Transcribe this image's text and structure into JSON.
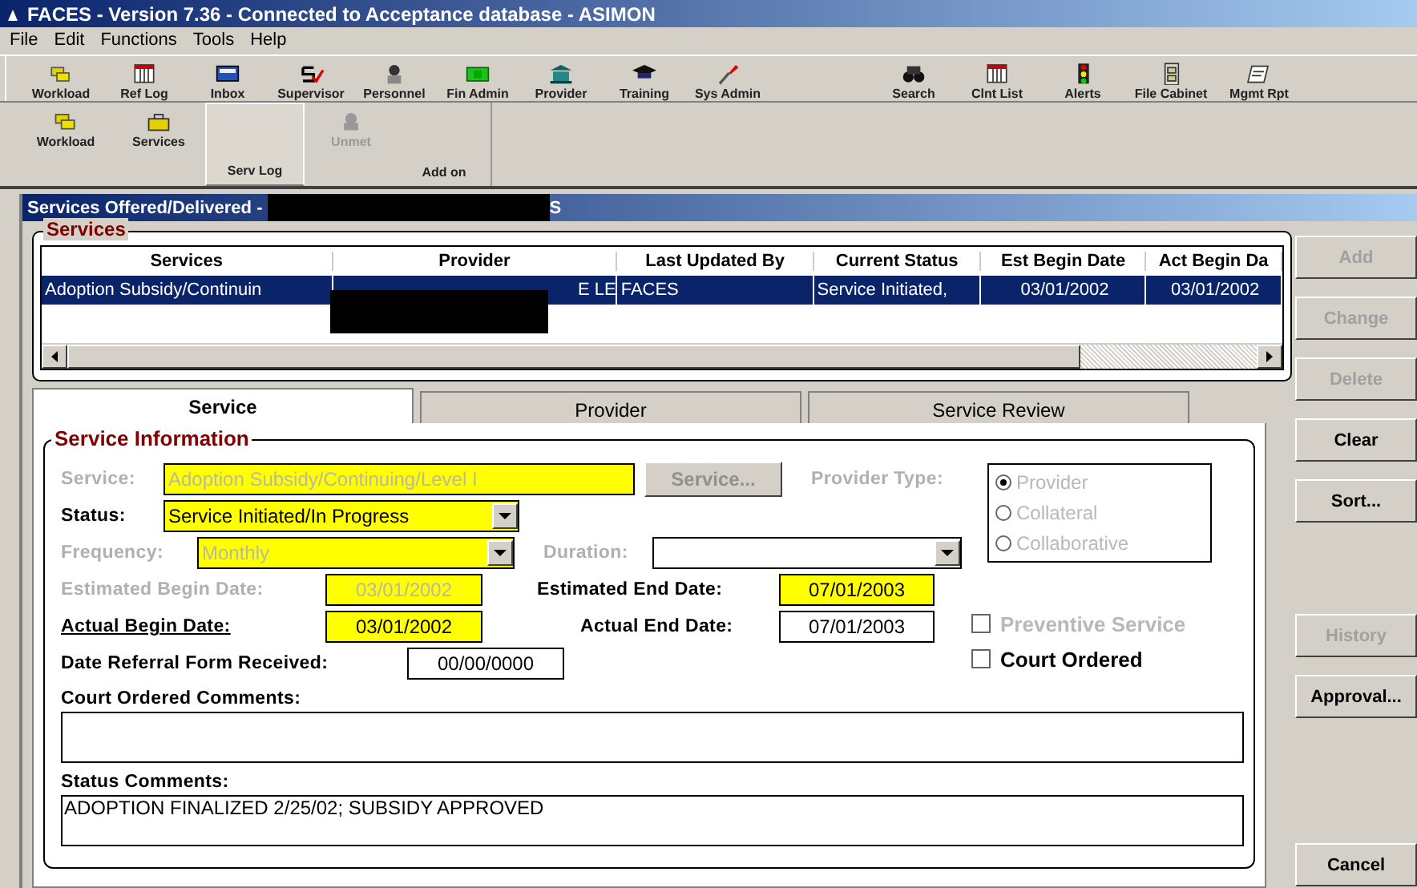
{
  "window": {
    "title": "FACES - Version 7.36 - Connected to Acceptance database - ASIMON"
  },
  "menu": [
    "File",
    "Edit",
    "Functions",
    "Tools",
    "Help"
  ],
  "toolbar": [
    {
      "label": "Workload"
    },
    {
      "label": "Ref Log"
    },
    {
      "label": "Inbox"
    },
    {
      "label": "Supervisor"
    },
    {
      "label": "Personnel"
    },
    {
      "label": "Fin Admin"
    },
    {
      "label": "Provider"
    },
    {
      "label": "Training"
    },
    {
      "label": "Sys Admin"
    },
    {
      "label": "Search"
    },
    {
      "label": "Clnt List"
    },
    {
      "label": "Alerts"
    },
    {
      "label": "File Cabinet"
    },
    {
      "label": "Mgmt Rpt"
    }
  ],
  "subtoolbar": [
    {
      "label": "Workload",
      "selected": false,
      "disabled": false
    },
    {
      "label": "Services",
      "selected": false,
      "disabled": false
    },
    {
      "label": "Serv Log",
      "selected": true,
      "disabled": false
    },
    {
      "label": "Unmet",
      "selected": false,
      "disabled": true
    },
    {
      "label": "Add on",
      "selected": false,
      "disabled": false
    }
  ],
  "document": {
    "title_start": "Services Offered/Delivered - ",
    "title_end": "S"
  },
  "services": {
    "title": "Services",
    "columns": [
      "Services",
      "Provider",
      "Last Updated By",
      "Current Status",
      "Est Begin Date",
      "Act Begin Da"
    ],
    "rows": [
      {
        "selected": true,
        "cells": [
          "Adoption Subsidy/Continuin",
          "E LE",
          "FACES",
          "Service Initiated,",
          "03/01/2002",
          "03/01/2002"
        ]
      }
    ]
  },
  "side_buttons": [
    {
      "label": "Add",
      "disabled": true
    },
    {
      "label": "Change",
      "disabled": true
    },
    {
      "label": "Delete",
      "disabled": true
    },
    {
      "label": "Clear",
      "disabled": false
    },
    {
      "label": "Sort...",
      "disabled": false
    },
    {
      "label": "History",
      "disabled": true
    },
    {
      "label": "Approval...",
      "disabled": false
    },
    {
      "label": "Cancel",
      "disabled": false
    }
  ],
  "tabs": [
    {
      "label": "Service",
      "selected": true
    },
    {
      "label": "Provider",
      "selected": false
    },
    {
      "label": "Service Review",
      "selected": false
    }
  ],
  "service_information": {
    "title": "Service Information",
    "service": {
      "label": "Service:",
      "value": "Adoption Subsidy/Continuing/Level I",
      "disabled": true,
      "required": true
    },
    "service_button": {
      "label": "Service...",
      "disabled": true
    },
    "provider_type": {
      "label": "Provider Type:",
      "disabled": true,
      "options": [
        {
          "label": "Provider",
          "selected": true
        },
        {
          "label": "Collateral",
          "selected": false
        },
        {
          "label": "Collaborative",
          "selected": false
        }
      ]
    },
    "status": {
      "label": "Status:",
      "value": "Service Initiated/In Progress",
      "disabled": false,
      "required": true
    },
    "frequency": {
      "label": "Frequency:",
      "value": "Monthly",
      "disabled": true,
      "required": true
    },
    "duration": {
      "label": "Duration:",
      "disabled": true,
      "required": false
    },
    "est_begin": {
      "label": "Estimated Begin Date:",
      "value": "03/01/2002",
      "disabled": true,
      "required": true
    },
    "est_end": {
      "label": "Estimated End Date:",
      "value": "07/01/2003",
      "disabled": false,
      "required": true
    },
    "act_begin": {
      "label": "Actual Begin Date:",
      "value": "03/01/2002",
      "disabled": false,
      "required": true,
      "underlined": true
    },
    "act_end": {
      "label": "Actual End Date:",
      "value": "07/01/2003",
      "disabled": false,
      "required": false
    },
    "referral": {
      "label": "Date Referral Form Received:",
      "value": "00/00/0000",
      "disabled": false,
      "required": false
    },
    "preventive": {
      "label": "Preventive Service",
      "checked": false,
      "disabled": true
    },
    "court_ordered": {
      "label": "Court Ordered",
      "checked": false,
      "disabled": false
    },
    "court_comments": {
      "label": "Court Ordered Comments:"
    },
    "status_comments": {
      "label": "Status Comments:",
      "value": "ADOPTION FINALIZED 2/25/02; SUBSIDY APPROVED"
    }
  }
}
